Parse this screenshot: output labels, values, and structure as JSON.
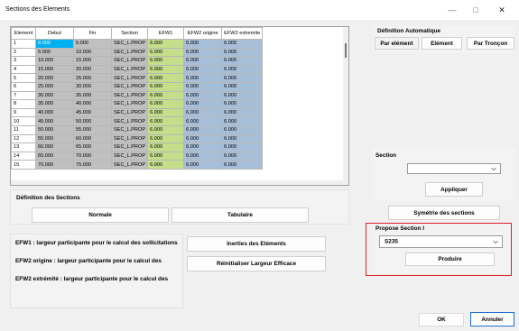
{
  "window": {
    "title": "Sections des Elements",
    "minimize": "—",
    "maximize": "□",
    "close": "✕"
  },
  "grid": {
    "columns": [
      "Element",
      "Debut",
      "Fin",
      "Section",
      "EFW1",
      "EFW2 origine",
      "EFW2 extremite"
    ],
    "rows": [
      [
        "1",
        "0.000",
        "5.000",
        "SEC_L.PROP",
        "6.000",
        "6.000",
        "6.000"
      ],
      [
        "2",
        "5.000",
        "10.000",
        "SEC_L.PROP",
        "6.000",
        "6.000",
        "6.000"
      ],
      [
        "3",
        "10.000",
        "15.000",
        "SEC_L.PROP",
        "6.000",
        "6.000",
        "6.000"
      ],
      [
        "4",
        "15.000",
        "20.000",
        "SEC_L.PROP",
        "6.000",
        "6.000",
        "6.000"
      ],
      [
        "5",
        "20.000",
        "25.000",
        "SEC_L.PROP",
        "6.000",
        "6.000",
        "6.000"
      ],
      [
        "6",
        "25.000",
        "30.000",
        "SEC_L.PROP",
        "6.000",
        "6.000",
        "6.000"
      ],
      [
        "7",
        "30.000",
        "35.000",
        "SEC_L.PROP",
        "6.000",
        "6.000",
        "6.000"
      ],
      [
        "8",
        "35.000",
        "40.000",
        "SEC_L.PROP",
        "6.000",
        "6.000",
        "6.000"
      ],
      [
        "9",
        "40.000",
        "45.000",
        "SEC_L.PROP",
        "6.000",
        "6.000",
        "6.000"
      ],
      [
        "10",
        "45.000",
        "50.000",
        "SEC_L.PROP",
        "6.000",
        "6.000",
        "6.000"
      ],
      [
        "11",
        "50.000",
        "55.000",
        "SEC_L.PROP",
        "6.000",
        "6.000",
        "6.000"
      ],
      [
        "12",
        "55.000",
        "60.000",
        "SEC_L.PROP",
        "6.000",
        "6.000",
        "6.000"
      ],
      [
        "13",
        "60.000",
        "65.000",
        "SEC_L.PROP",
        "6.000",
        "6.000",
        "6.000"
      ],
      [
        "14",
        "65.000",
        "70.000",
        "SEC_L.PROP",
        "6.000",
        "6.000",
        "6.000"
      ],
      [
        "15",
        "70.000",
        "75.000",
        "SEC_L.PROP",
        "6.000",
        "6.000",
        "6.000"
      ]
    ]
  },
  "definition_sections": {
    "title": "Définition des Sections",
    "normale": "Normale",
    "tabulaire": "Tabulaire"
  },
  "help": {
    "efw1": "EFW1 : largeur participante pour le calcul des sollicitations",
    "efw2_origine": "EFW2 origine : largeur participante pour le calcul des",
    "efw2_extremite": "EFW2 extrémité : largeur participante pour le calcul des"
  },
  "actions": {
    "inerties": "Inerties des Eléments",
    "reinitialiser": "Réinitialiser Largeur Efficace"
  },
  "definition_auto": {
    "title": "Définition Automatique",
    "par_element": "Par elément",
    "element": "Elément",
    "par_troncon": "Par Tronçon"
  },
  "section": {
    "title": "Section",
    "value": "",
    "appliquer": "Appliquer"
  },
  "symetrie": "Symétrie des sections",
  "propose": {
    "title": "Propose Section I",
    "value": "S235",
    "produire": "Produire"
  },
  "footer": {
    "ok": "OK",
    "annuler": "Annuler"
  }
}
